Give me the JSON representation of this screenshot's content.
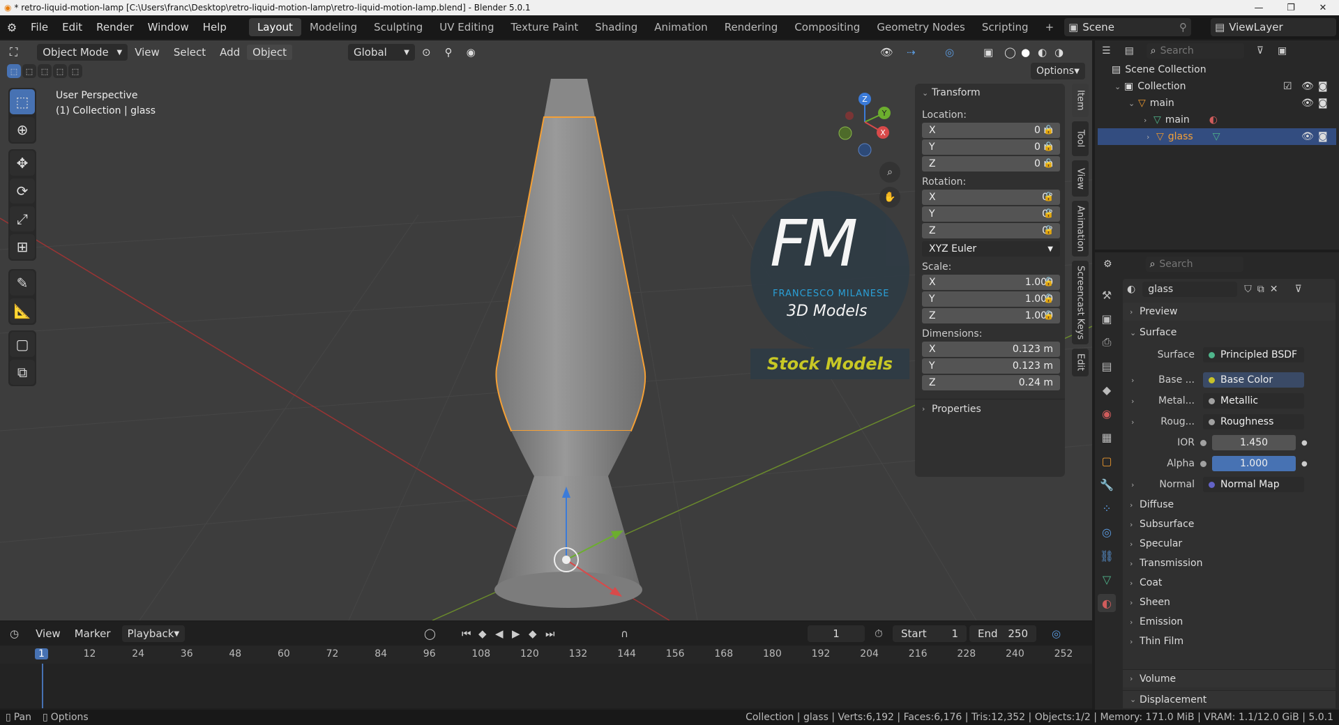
{
  "window": {
    "title": "* retro-liquid-motion-lamp [C:\\Users\\franc\\Desktop\\retro-liquid-motion-lamp\\retro-liquid-motion-lamp.blend] - Blender 5.0.1",
    "controls": [
      "—",
      "❐",
      "✕"
    ]
  },
  "menu": [
    "File",
    "Edit",
    "Render",
    "Window",
    "Help"
  ],
  "workspaces": [
    "Layout",
    "Modeling",
    "Sculpting",
    "UV Editing",
    "Texture Paint",
    "Shading",
    "Animation",
    "Rendering",
    "Compositing",
    "Geometry Nodes",
    "Scripting"
  ],
  "workspace_add": "+",
  "scene": {
    "label": "Scene",
    "view_layer": "ViewLayer"
  },
  "viewport": {
    "mode": "Object Mode",
    "header_menus": [
      "View",
      "Select",
      "Add",
      "Object"
    ],
    "active_menu": "Object",
    "orientation": "Global",
    "options_label": "Options",
    "overlay_title": "User Perspective",
    "overlay_sub": "(1) Collection | glass",
    "gizmo_axes": {
      "z": "Z",
      "y": "Y",
      "x": "X"
    }
  },
  "watermark": {
    "logo": "FM",
    "name": "FRANCESCO MILANESE",
    "tagline": "3D Models",
    "banner": "Stock Models"
  },
  "npanel": {
    "title": "Transform",
    "location_label": "Location:",
    "location": [
      {
        "axis": "X",
        "value": "0 m"
      },
      {
        "axis": "Y",
        "value": "0 m"
      },
      {
        "axis": "Z",
        "value": "0 m"
      }
    ],
    "rotation_label": "Rotation:",
    "rotation": [
      {
        "axis": "X",
        "value": "0°"
      },
      {
        "axis": "Y",
        "value": "0°"
      },
      {
        "axis": "Z",
        "value": "0°"
      }
    ],
    "rotation_mode": "XYZ Euler",
    "scale_label": "Scale:",
    "scale": [
      {
        "axis": "X",
        "value": "1.000"
      },
      {
        "axis": "Y",
        "value": "1.000"
      },
      {
        "axis": "Z",
        "value": "1.000"
      }
    ],
    "dimensions_label": "Dimensions:",
    "dimensions": [
      {
        "axis": "X",
        "value": "0.123 m"
      },
      {
        "axis": "Y",
        "value": "0.123 m"
      },
      {
        "axis": "Z",
        "value": "0.24 m"
      }
    ],
    "properties_label": "Properties",
    "tabs": [
      "Item",
      "Tool",
      "View",
      "Animation",
      "Screencast Keys",
      "Edit"
    ]
  },
  "timeline": {
    "menus": [
      "View",
      "Marker",
      "Playback"
    ],
    "current_frame": "1",
    "start_label": "Start",
    "start": "1",
    "end_label": "End",
    "end": "250",
    "ticks": [
      "1",
      "12",
      "24",
      "36",
      "48",
      "60",
      "72",
      "84",
      "96",
      "108",
      "120",
      "132",
      "144",
      "156",
      "168",
      "180",
      "192",
      "204",
      "216",
      "228",
      "240",
      "252"
    ]
  },
  "outliner": {
    "search_placeholder": "Search",
    "root": "Scene Collection",
    "collection": "Collection",
    "items": [
      {
        "name": "main"
      },
      {
        "name": "main"
      },
      {
        "name": "glass"
      }
    ]
  },
  "properties": {
    "search_placeholder": "Search",
    "material_name": "glass",
    "sections_top": [
      "Preview",
      "Surface"
    ],
    "surface_label": "Surface",
    "surface_value": "Principled BSDF",
    "inputs": [
      {
        "label": "Base ...",
        "value": "Base Color",
        "color": "#c7c229"
      },
      {
        "label": "Metal...",
        "value": "Metallic",
        "color": "#a1a1a1"
      },
      {
        "label": "Roug...",
        "value": "Roughness",
        "color": "#a1a1a1"
      },
      {
        "label": "IOR",
        "value": "1.450",
        "color": "#a1a1a1"
      },
      {
        "label": "Alpha",
        "value": "1.000",
        "color": "#a1a1a1"
      },
      {
        "label": "Normal",
        "value": "Normal Map",
        "color": "#6363c7"
      }
    ],
    "subsections": [
      "Diffuse",
      "Subsurface",
      "Specular",
      "Transmission",
      "Coat",
      "Sheen",
      "Emission",
      "Thin Film"
    ],
    "sections_bottom": [
      "Volume",
      "Displacement"
    ]
  },
  "status": {
    "left": [
      "Pan",
      "Options"
    ],
    "right": "Collection | glass | Verts:6,192 | Faces:6,176 | Tris:12,352 | Objects:1/2 | Memory: 171.0 MiB | VRAM: 1.1/12.0 GiB | 5.0.1"
  },
  "colors": {
    "accent": "#4772b3",
    "selection": "#f5a035",
    "watermark_blue": "#2aa6e0",
    "banner_yellow": "#c8c825"
  }
}
